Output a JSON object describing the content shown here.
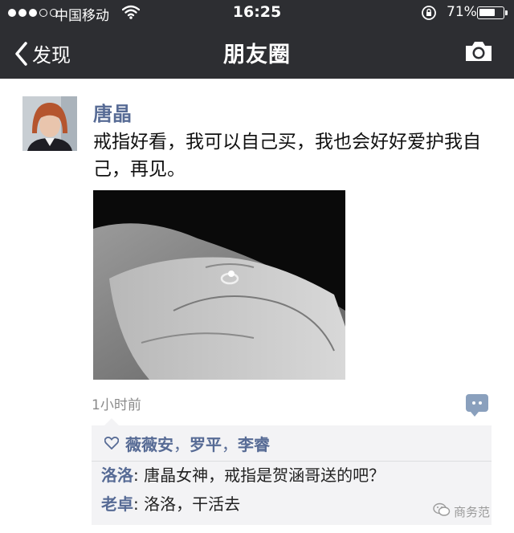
{
  "status_bar": {
    "carrier": "中国移动",
    "time": "16:25",
    "battery_percent": "71%",
    "battery_level": 0.71,
    "signal_strength": 3,
    "signal_max": 5
  },
  "nav": {
    "back_label": "发现",
    "title": "朋友圈"
  },
  "post": {
    "author": "唐晶",
    "text": "戒指好看，我可以自己买，我也会好好爱护我自己，再见。",
    "timestamp": "1小时前",
    "likes": [
      "薇薇安",
      "罗平",
      "李睿"
    ],
    "like_separator": "，",
    "comments": [
      {
        "name": "洛洛",
        "text": "唐晶女神，戒指是贺涵哥送的吧？"
      },
      {
        "name": "老卓",
        "text": "洛洛，干活去"
      }
    ]
  },
  "watermark": "商务范",
  "colors": {
    "bar_bg": "#2d2e32",
    "link": "#576b95",
    "box_bg": "#f3f3f5"
  }
}
